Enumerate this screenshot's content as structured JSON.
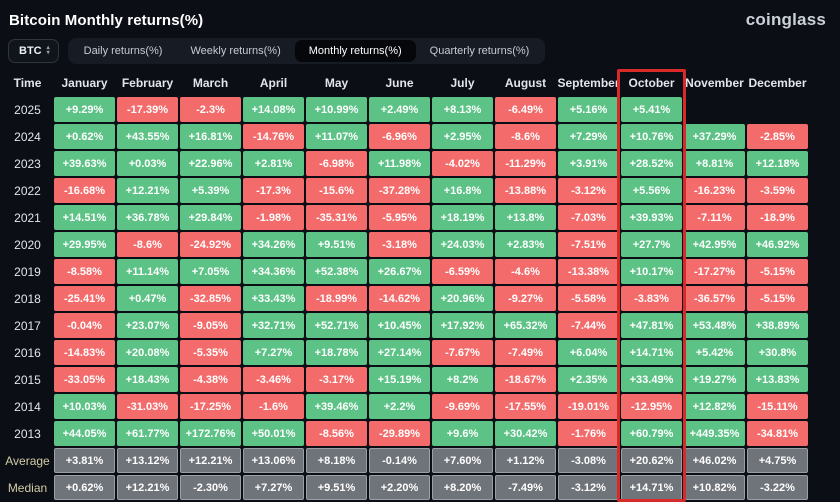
{
  "header": {
    "title": "Bitcoin Monthly returns(%)",
    "logo": "coinglass"
  },
  "toolbar": {
    "coin_selector": {
      "label": "BTC"
    },
    "tabs": [
      {
        "label": "Daily returns(%)",
        "active": false
      },
      {
        "label": "Weekly returns(%)",
        "active": false
      },
      {
        "label": "Monthly returns(%)",
        "active": true
      },
      {
        "label": "Quarterly returns(%)",
        "active": false
      }
    ]
  },
  "table": {
    "time_header": "Time",
    "columns": [
      "January",
      "February",
      "March",
      "April",
      "May",
      "June",
      "July",
      "August",
      "September",
      "October",
      "November",
      "December"
    ],
    "highlight_column": "October",
    "rows": [
      {
        "label": "2025",
        "type": "year",
        "values": [
          "+9.29%",
          "-17.39%",
          "-2.3%",
          "+14.08%",
          "+10.99%",
          "+2.49%",
          "+8.13%",
          "-6.49%",
          "+5.16%",
          "+5.41%",
          "",
          ""
        ]
      },
      {
        "label": "2024",
        "type": "year",
        "values": [
          "+0.62%",
          "+43.55%",
          "+16.81%",
          "-14.76%",
          "+11.07%",
          "-6.96%",
          "+2.95%",
          "-8.6%",
          "+7.29%",
          "+10.76%",
          "+37.29%",
          "-2.85%"
        ]
      },
      {
        "label": "2023",
        "type": "year",
        "values": [
          "+39.63%",
          "+0.03%",
          "+22.96%",
          "+2.81%",
          "-6.98%",
          "+11.98%",
          "-4.02%",
          "-11.29%",
          "+3.91%",
          "+28.52%",
          "+8.81%",
          "+12.18%"
        ]
      },
      {
        "label": "2022",
        "type": "year",
        "values": [
          "-16.68%",
          "+12.21%",
          "+5.39%",
          "-17.3%",
          "-15.6%",
          "-37.28%",
          "+16.8%",
          "-13.88%",
          "-3.12%",
          "+5.56%",
          "-16.23%",
          "-3.59%"
        ]
      },
      {
        "label": "2021",
        "type": "year",
        "values": [
          "+14.51%",
          "+36.78%",
          "+29.84%",
          "-1.98%",
          "-35.31%",
          "-5.95%",
          "+18.19%",
          "+13.8%",
          "-7.03%",
          "+39.93%",
          "-7.11%",
          "-18.9%"
        ]
      },
      {
        "label": "2020",
        "type": "year",
        "values": [
          "+29.95%",
          "-8.6%",
          "-24.92%",
          "+34.26%",
          "+9.51%",
          "-3.18%",
          "+24.03%",
          "+2.83%",
          "-7.51%",
          "+27.7%",
          "+42.95%",
          "+46.92%"
        ]
      },
      {
        "label": "2019",
        "type": "year",
        "values": [
          "-8.58%",
          "+11.14%",
          "+7.05%",
          "+34.36%",
          "+52.38%",
          "+26.67%",
          "-6.59%",
          "-4.6%",
          "-13.38%",
          "+10.17%",
          "-17.27%",
          "-5.15%"
        ]
      },
      {
        "label": "2018",
        "type": "year",
        "values": [
          "-25.41%",
          "+0.47%",
          "-32.85%",
          "+33.43%",
          "-18.99%",
          "-14.62%",
          "+20.96%",
          "-9.27%",
          "-5.58%",
          "-3.83%",
          "-36.57%",
          "-5.15%"
        ]
      },
      {
        "label": "2017",
        "type": "year",
        "values": [
          "-0.04%",
          "+23.07%",
          "-9.05%",
          "+32.71%",
          "+52.71%",
          "+10.45%",
          "+17.92%",
          "+65.32%",
          "-7.44%",
          "+47.81%",
          "+53.48%",
          "+38.89%"
        ]
      },
      {
        "label": "2016",
        "type": "year",
        "values": [
          "-14.83%",
          "+20.08%",
          "-5.35%",
          "+7.27%",
          "+18.78%",
          "+27.14%",
          "-7.67%",
          "-7.49%",
          "+6.04%",
          "+14.71%",
          "+5.42%",
          "+30.8%"
        ]
      },
      {
        "label": "2015",
        "type": "year",
        "values": [
          "-33.05%",
          "+18.43%",
          "-4.38%",
          "-3.46%",
          "-3.17%",
          "+15.19%",
          "+8.2%",
          "-18.67%",
          "+2.35%",
          "+33.49%",
          "+19.27%",
          "+13.83%"
        ]
      },
      {
        "label": "2014",
        "type": "year",
        "values": [
          "+10.03%",
          "-31.03%",
          "-17.25%",
          "-1.6%",
          "+39.46%",
          "+2.2%",
          "-9.69%",
          "-17.55%",
          "-19.01%",
          "-12.95%",
          "+12.82%",
          "-15.11%"
        ]
      },
      {
        "label": "2013",
        "type": "year",
        "values": [
          "+44.05%",
          "+61.77%",
          "+172.76%",
          "+50.01%",
          "-8.56%",
          "-29.89%",
          "+9.6%",
          "+30.42%",
          "-1.76%",
          "+60.79%",
          "+449.35%",
          "-34.81%"
        ]
      },
      {
        "label": "Average",
        "type": "summary",
        "values": [
          "+3.81%",
          "+13.12%",
          "+12.21%",
          "+13.06%",
          "+8.18%",
          "-0.14%",
          "+7.60%",
          "+1.12%",
          "-3.08%",
          "+20.62%",
          "+46.02%",
          "+4.75%"
        ]
      },
      {
        "label": "Median",
        "type": "summary",
        "values": [
          "+0.62%",
          "+12.21%",
          "-2.30%",
          "+7.27%",
          "+9.51%",
          "+2.20%",
          "+8.20%",
          "-7.49%",
          "-3.12%",
          "+14.71%",
          "+10.82%",
          "-3.22%"
        ]
      }
    ]
  },
  "icons": {
    "chevron_up": "▴",
    "chevron_down": "▾"
  },
  "colors": {
    "positive": "#5cc286",
    "negative": "#f46b6b",
    "summary_cell": "#6f737a",
    "highlight_border": "#d92a2a",
    "background": "#0b0e14"
  }
}
